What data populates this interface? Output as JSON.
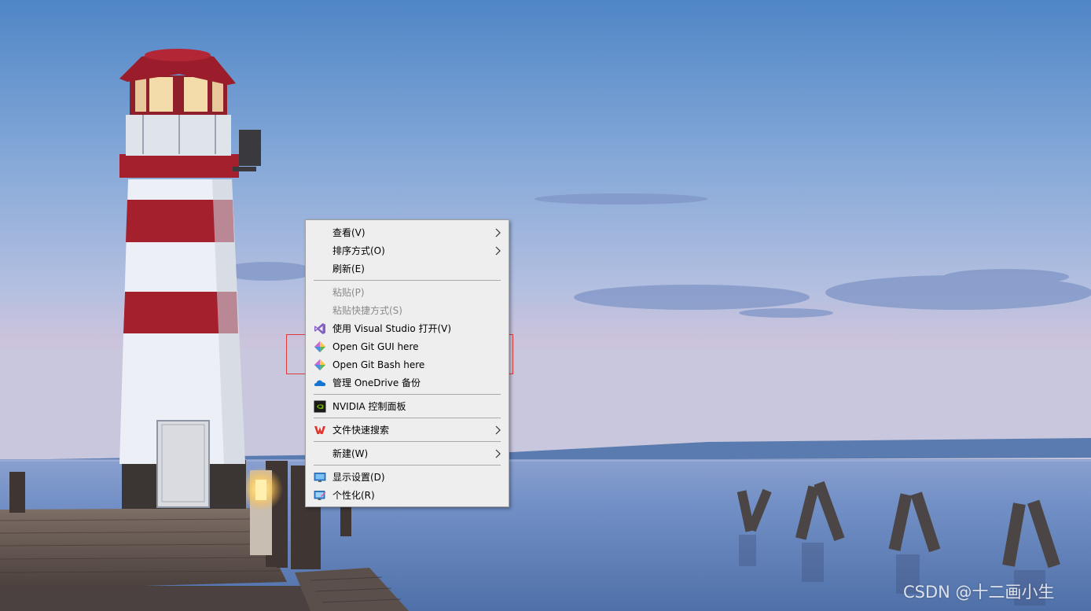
{
  "context_menu": {
    "items": [
      {
        "label": "查看(V)",
        "icon": "",
        "has_submenu": true,
        "disabled": false
      },
      {
        "label": "排序方式(O)",
        "icon": "",
        "has_submenu": true,
        "disabled": false
      },
      {
        "label": "刷新(E)",
        "icon": "",
        "has_submenu": false,
        "disabled": false
      },
      {
        "label": "粘贴(P)",
        "icon": "",
        "has_submenu": false,
        "disabled": true
      },
      {
        "label": "粘贴快捷方式(S)",
        "icon": "",
        "has_submenu": false,
        "disabled": true
      },
      {
        "label": "使用 Visual Studio 打开(V)",
        "icon": "visual-studio-icon",
        "has_submenu": false,
        "disabled": false
      },
      {
        "label": "Open Git GUI here",
        "icon": "git-gui-icon",
        "has_submenu": false,
        "disabled": false
      },
      {
        "label": "Open Git Bash here",
        "icon": "git-bash-icon",
        "has_submenu": false,
        "disabled": false
      },
      {
        "label": "管理 OneDrive 备份",
        "icon": "onedrive-icon",
        "has_submenu": false,
        "disabled": false
      },
      {
        "label": "NVIDIA 控制面板",
        "icon": "nvidia-icon",
        "has_submenu": false,
        "disabled": false
      },
      {
        "label": "文件快速搜索",
        "icon": "wps-icon",
        "has_submenu": true,
        "disabled": false
      },
      {
        "label": "新建(W)",
        "icon": "",
        "has_submenu": true,
        "disabled": false
      },
      {
        "label": "显示设置(D)",
        "icon": "display-settings-icon",
        "has_submenu": false,
        "disabled": false
      },
      {
        "label": "个性化(R)",
        "icon": "personalize-icon",
        "has_submenu": false,
        "disabled": false
      }
    ]
  },
  "highlight": {
    "color": "#e03a3a"
  },
  "watermark": {
    "text": "CSDN @十二画小生"
  },
  "colors": {
    "menu_bg": "#eeeeee",
    "disabled_text": "#8a8a8a",
    "lighthouse_red": "#a3202c",
    "sky_top": "#5b8dc9",
    "water": "#5f80b8"
  }
}
